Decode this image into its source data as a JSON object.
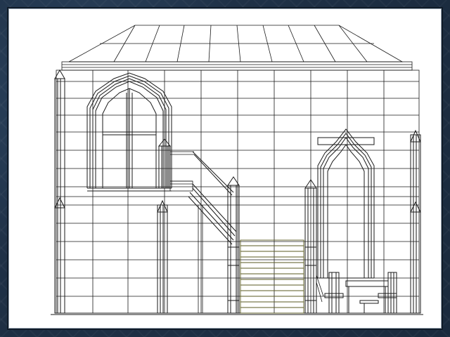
{
  "viewport": {
    "background": "#ffffff",
    "line_color": "#1a1a1a",
    "accent_line_color": "#5a5a20"
  },
  "frame": {
    "color": "#1f3147"
  },
  "scene": {
    "subject": "wireframe-chapel-interior",
    "left_window": {
      "shape": "gothic-arch"
    },
    "right_window": {
      "shape": "gothic-arch"
    },
    "staircase": {
      "type": "dog-leg"
    },
    "chair": {
      "visible": true
    }
  }
}
